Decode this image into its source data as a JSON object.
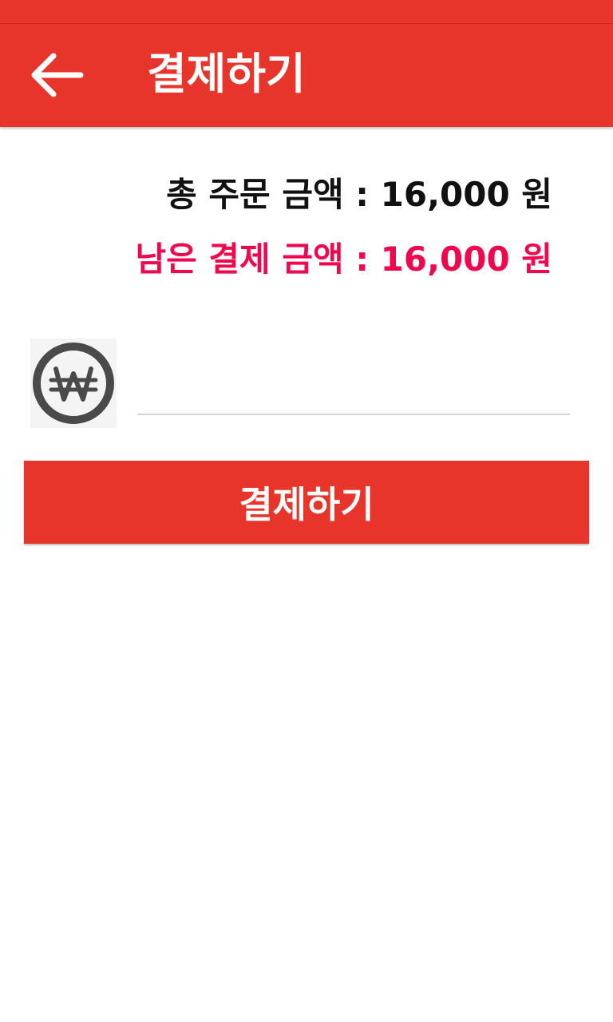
{
  "app_bar": {
    "title": "결제하기",
    "back_icon": "arrow-left-icon",
    "color": "#e8352b"
  },
  "totals": {
    "total_label": "총 주문 금액",
    "total_value": "16,000",
    "remaining_label": "남은 결제 금액",
    "remaining_value": "16,000",
    "separator": ":",
    "currency_unit": "원",
    "remaining_color": "#f0084f"
  },
  "amount_input": {
    "icon": "won-icon",
    "value": "",
    "placeholder": ""
  },
  "pay_button": {
    "label": "결제하기"
  }
}
